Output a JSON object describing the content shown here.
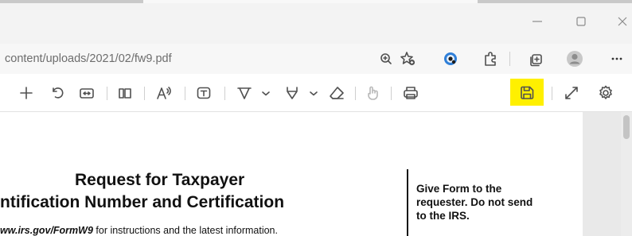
{
  "window": {
    "controls": [
      "minimize-icon",
      "maximize-icon",
      "close-icon"
    ]
  },
  "address_bar": {
    "url": "content/uploads/2021/02/fw9.pdf",
    "icons": [
      "zoom-icon",
      "add-favorite-icon",
      "extension-icon",
      "puzzle-icon",
      "collections-icon",
      "profile-avatar",
      "more-icon"
    ]
  },
  "pdf_toolbar": {
    "icons": [
      "zoom-in-icon",
      "rotate-icon",
      "fit-page-icon",
      "page-view-icon",
      "read-aloud-icon",
      "add-text-icon",
      "draw-icon",
      "draw-options-chevron-icon",
      "highlight-icon",
      "highlight-options-chevron-icon",
      "eraser-icon",
      "touch-icon",
      "print-icon",
      "save-icon",
      "fullscreen-icon",
      "settings-icon"
    ],
    "highlighted": "save-icon",
    "highlight_color": "#fff000"
  },
  "document": {
    "title_line1": "Request for Taxpayer",
    "title_line2": "ntification Number and Certification",
    "url_link": "ww.irs.gov/FormW9",
    "url_rest": " for instructions and the latest information.",
    "side_note": "Give Form to the requester. Do not send to the IRS."
  }
}
